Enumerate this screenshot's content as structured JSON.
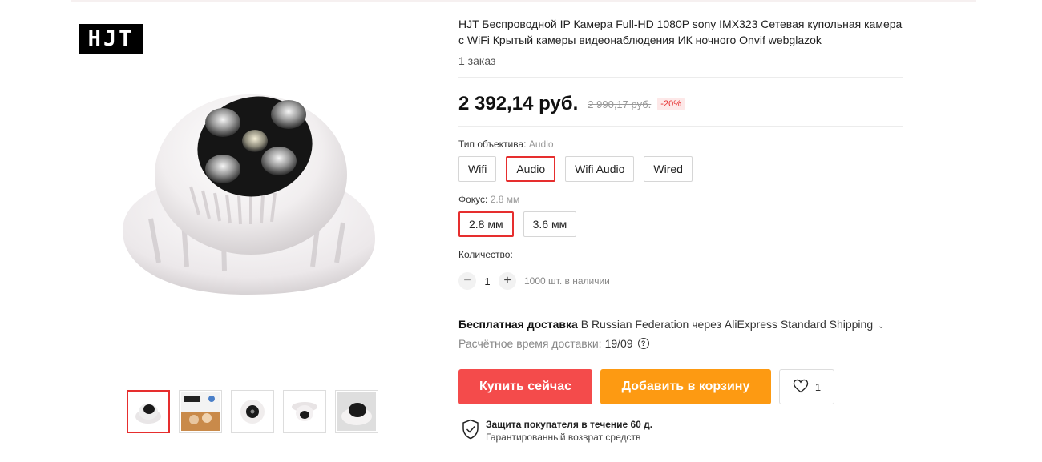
{
  "brand": {
    "logo_text": "HJT"
  },
  "product": {
    "title": "HJT Беспроводной IP Камера Full-HD 1080P sony IMX323 Сетевая купольная камера с WiFi Крытый камеры видеонаблюдения ИК ночного Onvif webglazok",
    "orders": "1 заказ",
    "price": "2 392,14 руб.",
    "old_price": "2 990,17 руб.",
    "discount": "-20%"
  },
  "lens_type": {
    "label": "Тип объектива:",
    "selected": "Audio",
    "options": [
      "Wifi",
      "Audio",
      "Wifi Audio",
      "Wired"
    ]
  },
  "focus": {
    "label": "Фокус:",
    "selected": "2.8 мм",
    "options": [
      "2.8 мм",
      "3.6 мм"
    ]
  },
  "quantity": {
    "label": "Количество:",
    "minus": "−",
    "value": "1",
    "plus": "+",
    "stock": "1000 шт. в наличии"
  },
  "shipping": {
    "free_label": "Бесплатная доставка",
    "details": " В Russian Federation через AliExpress Standard Shipping",
    "chevron": "⌄",
    "estimate_label": "Расчётное время доставки:",
    "estimate_date": "19/09",
    "help": "?"
  },
  "actions": {
    "buy_now": "Купить сейчас",
    "add_to_cart": "Добавить в корзину",
    "wishlist_count": "1"
  },
  "protection": {
    "title": "Защита покупателя в течение 60 д.",
    "subtitle": "Гарантированный возврат средств"
  },
  "gallery": {
    "thumbnails": [
      "thumb-1",
      "thumb-2",
      "thumb-3",
      "thumb-4",
      "thumb-5"
    ],
    "active_index": 0
  },
  "colors": {
    "accent_red": "#e62e2e",
    "buy_button": "#f44b4b",
    "cart_button": "#fd9a12"
  }
}
